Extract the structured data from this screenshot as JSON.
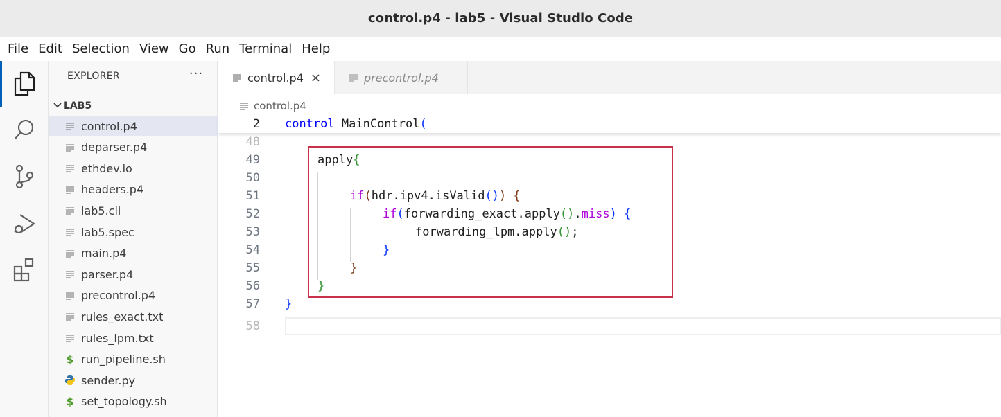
{
  "window": {
    "title": "control.p4 - lab5 - Visual Studio Code"
  },
  "menu": [
    "File",
    "Edit",
    "Selection",
    "View",
    "Go",
    "Run",
    "Terminal",
    "Help"
  ],
  "activity_bar": [
    "explorer-icon",
    "search-icon",
    "source-control-icon",
    "run-debug-icon",
    "extensions-icon"
  ],
  "explorer": {
    "header": "EXPLORER",
    "more": "···",
    "folder": "LAB5",
    "files": [
      {
        "name": "control.p4",
        "icon": "text-file-icon",
        "selected": true
      },
      {
        "name": "deparser.p4",
        "icon": "text-file-icon"
      },
      {
        "name": "ethdev.io",
        "icon": "text-file-icon"
      },
      {
        "name": "headers.p4",
        "icon": "text-file-icon"
      },
      {
        "name": "lab5.cli",
        "icon": "text-file-icon"
      },
      {
        "name": "lab5.spec",
        "icon": "text-file-icon"
      },
      {
        "name": "main.p4",
        "icon": "text-file-icon"
      },
      {
        "name": "parser.p4",
        "icon": "text-file-icon"
      },
      {
        "name": "precontrol.p4",
        "icon": "text-file-icon"
      },
      {
        "name": "rules_exact.txt",
        "icon": "text-file-icon"
      },
      {
        "name": "rules_lpm.txt",
        "icon": "text-file-icon"
      },
      {
        "name": "run_pipeline.sh",
        "icon": "shell-script-icon"
      },
      {
        "name": "sender.py",
        "icon": "python-icon"
      },
      {
        "name": "set_topology.sh",
        "icon": "shell-script-icon"
      }
    ]
  },
  "tabs": [
    {
      "label": "control.p4",
      "active": true,
      "close": "×"
    },
    {
      "label": "precontrol.p4",
      "active": false,
      "preview": true
    }
  ],
  "breadcrumb": "control.p4",
  "editor": {
    "sticky": {
      "num": "2",
      "kw": "control",
      "name": " MainControl",
      "paren": "("
    },
    "lines": [
      {
        "num": "48"
      },
      {
        "num": "49",
        "t1": "apply",
        "t2": "{"
      },
      {
        "num": "50"
      },
      {
        "num": "51",
        "t1": "if",
        "t2": "(",
        "t3": "hdr.ipv4.isValid",
        "t4": "()",
        "t5": ")",
        "t6": " ",
        "t7": "{"
      },
      {
        "num": "52",
        "t1": "if",
        "t2": "(",
        "t3": "forwarding_exact.apply",
        "t4": "()",
        "t5": ".",
        "t6": "miss",
        "t7": ")",
        "t8": " ",
        "t9": "{"
      },
      {
        "num": "53",
        "t1": "forwarding_lpm.apply",
        "t2": "()",
        "t3": ";"
      },
      {
        "num": "54",
        "t1": "}"
      },
      {
        "num": "55",
        "t1": "}"
      },
      {
        "num": "56",
        "t1": "}"
      },
      {
        "num": "57",
        "t1": "}"
      },
      {
        "num": "58"
      }
    ]
  },
  "colors": {
    "highlight_box": "#c9304a",
    "accent": "#005fb8"
  }
}
